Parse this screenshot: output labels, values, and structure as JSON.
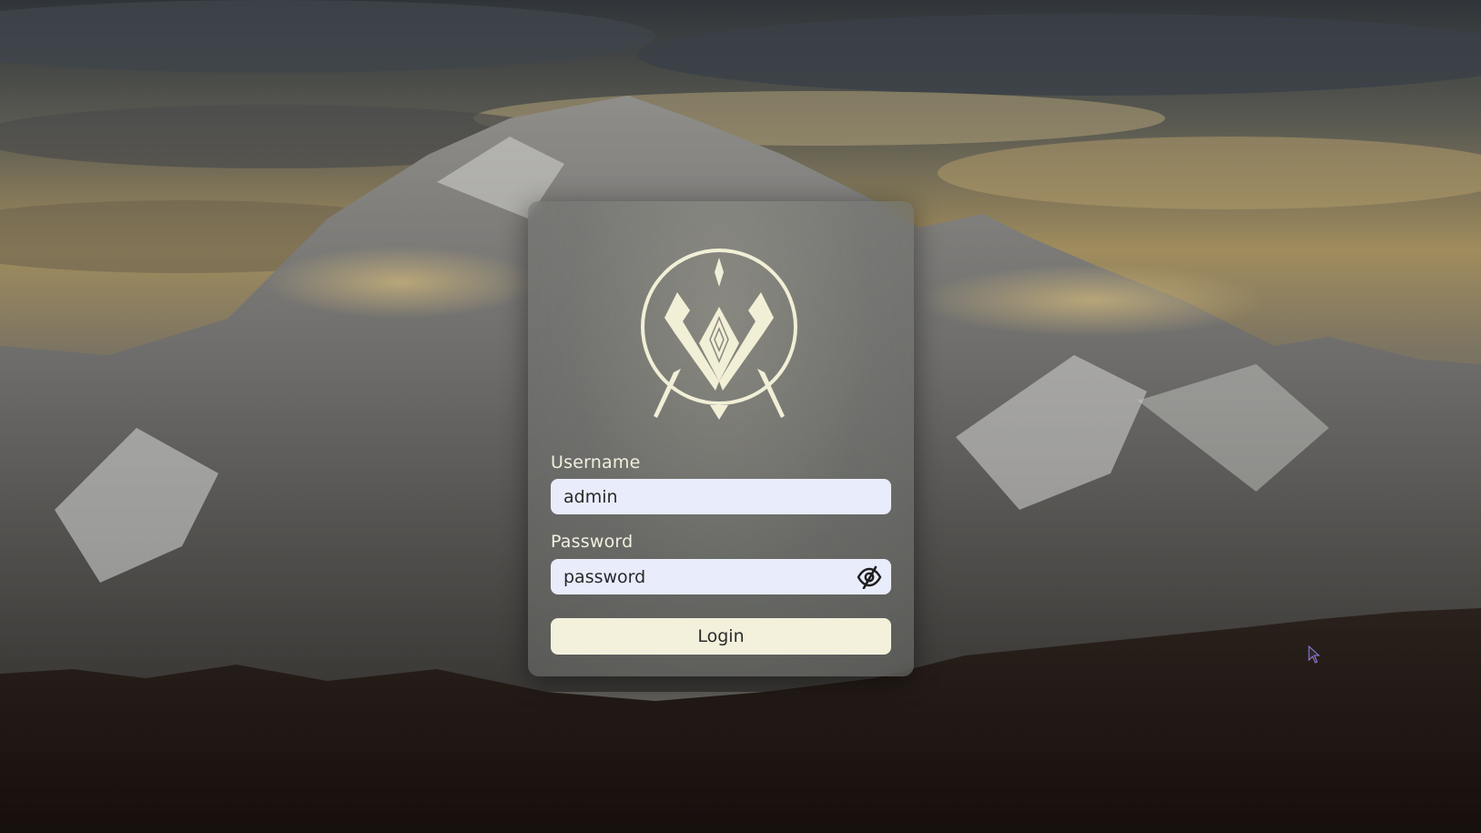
{
  "login": {
    "username_label": "Username",
    "username_value": "admin",
    "password_label": "Password",
    "password_value": "password",
    "login_button": "Login",
    "password_toggle_icon": "eye-slash-icon"
  },
  "branding": {
    "logo_icon": "crest-logo-icon"
  },
  "colors": {
    "logo": "#f1efd6",
    "input_bg": "#e8ecfb",
    "button_bg": "#f3f1dc",
    "label_text": "#f1efde"
  }
}
